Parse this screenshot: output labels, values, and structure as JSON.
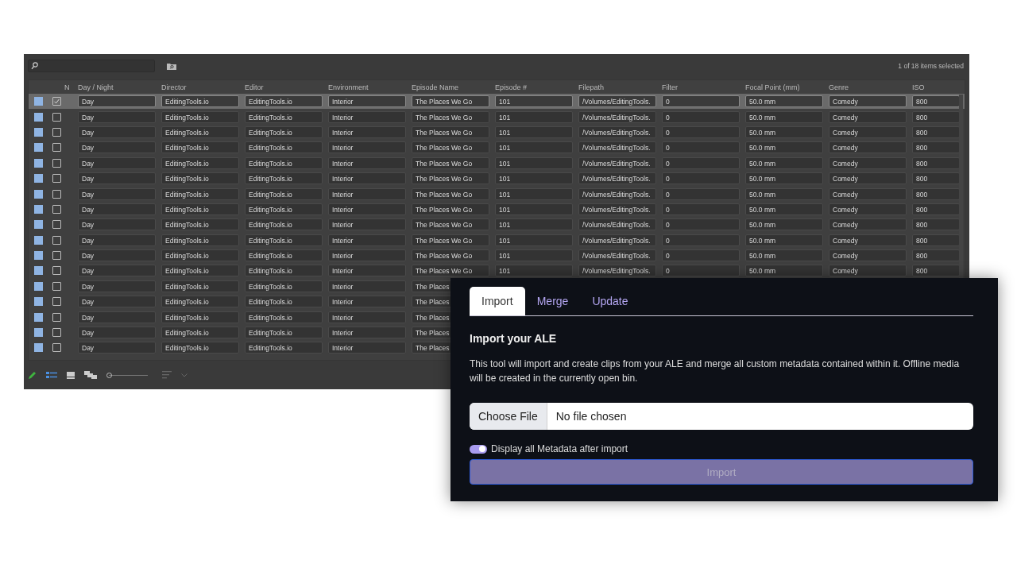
{
  "bin": {
    "status": "1 of 18 items selected",
    "n_header": "N",
    "columns": [
      "Day / Night",
      "Director",
      "Editor",
      "Environment",
      "Episode Name",
      "Episode #",
      "Filepath",
      "Filter",
      "Focal Point (mm)",
      "Genre",
      "ISO"
    ],
    "rows": [
      {
        "selected": true,
        "checked": true,
        "cells": [
          "Day",
          "EditingTools.io",
          "EditingTools.io",
          "Interior",
          "The Places We Go",
          "101",
          "/Volumes/EditingTools.",
          "0",
          "50.0 mm",
          "Comedy",
          "800"
        ]
      },
      {
        "selected": false,
        "checked": false,
        "cells": [
          "Day",
          "EditingTools.io",
          "EditingTools.io",
          "Interior",
          "The Places We Go",
          "101",
          "/Volumes/EditingTools.",
          "0",
          "50.0 mm",
          "Comedy",
          "800"
        ]
      },
      {
        "selected": false,
        "checked": false,
        "cells": [
          "Day",
          "EditingTools.io",
          "EditingTools.io",
          "Interior",
          "The Places We Go",
          "101",
          "/Volumes/EditingTools.",
          "0",
          "50.0 mm",
          "Comedy",
          "800"
        ]
      },
      {
        "selected": false,
        "checked": false,
        "cells": [
          "Day",
          "EditingTools.io",
          "EditingTools.io",
          "Interior",
          "The Places We Go",
          "101",
          "/Volumes/EditingTools.",
          "0",
          "50.0 mm",
          "Comedy",
          "800"
        ]
      },
      {
        "selected": false,
        "checked": false,
        "cells": [
          "Day",
          "EditingTools.io",
          "EditingTools.io",
          "Interior",
          "The Places We Go",
          "101",
          "/Volumes/EditingTools.",
          "0",
          "50.0 mm",
          "Comedy",
          "800"
        ]
      },
      {
        "selected": false,
        "checked": false,
        "cells": [
          "Day",
          "EditingTools.io",
          "EditingTools.io",
          "Interior",
          "The Places We Go",
          "101",
          "/Volumes/EditingTools.",
          "0",
          "50.0 mm",
          "Comedy",
          "800"
        ]
      },
      {
        "selected": false,
        "checked": false,
        "cells": [
          "Day",
          "EditingTools.io",
          "EditingTools.io",
          "Interior",
          "The Places We Go",
          "101",
          "/Volumes/EditingTools.",
          "0",
          "50.0 mm",
          "Comedy",
          "800"
        ]
      },
      {
        "selected": false,
        "checked": false,
        "cells": [
          "Day",
          "EditingTools.io",
          "EditingTools.io",
          "Interior",
          "The Places We Go",
          "101",
          "/Volumes/EditingTools.",
          "0",
          "50.0 mm",
          "Comedy",
          "800"
        ]
      },
      {
        "selected": false,
        "checked": false,
        "cells": [
          "Day",
          "EditingTools.io",
          "EditingTools.io",
          "Interior",
          "The Places We Go",
          "101",
          "/Volumes/EditingTools.",
          "0",
          "50.0 mm",
          "Comedy",
          "800"
        ]
      },
      {
        "selected": false,
        "checked": false,
        "cells": [
          "Day",
          "EditingTools.io",
          "EditingTools.io",
          "Interior",
          "The Places We Go",
          "101",
          "/Volumes/EditingTools.",
          "0",
          "50.0 mm",
          "Comedy",
          "800"
        ]
      },
      {
        "selected": false,
        "checked": false,
        "cells": [
          "Day",
          "EditingTools.io",
          "EditingTools.io",
          "Interior",
          "The Places We Go",
          "101",
          "/Volumes/EditingTools.",
          "0",
          "50.0 mm",
          "Comedy",
          "800"
        ]
      },
      {
        "selected": false,
        "checked": false,
        "cells": [
          "Day",
          "EditingTools.io",
          "EditingTools.io",
          "Interior",
          "The Places We Go",
          "101",
          "/Volumes/EditingTools.",
          "0",
          "50.0 mm",
          "Comedy",
          "800"
        ]
      },
      {
        "selected": false,
        "checked": false,
        "cells": [
          "Day",
          "EditingTools.io",
          "EditingTools.io",
          "Interior",
          "The Places"
        ]
      },
      {
        "selected": false,
        "checked": false,
        "cells": [
          "Day",
          "EditingTools.io",
          "EditingTools.io",
          "Interior",
          "The Places"
        ]
      },
      {
        "selected": false,
        "checked": false,
        "cells": [
          "Day",
          "EditingTools.io",
          "EditingTools.io",
          "Interior",
          "The Places"
        ]
      },
      {
        "selected": false,
        "checked": false,
        "cells": [
          "Day",
          "EditingTools.io",
          "EditingTools.io",
          "Interior",
          "The Places"
        ]
      },
      {
        "selected": false,
        "checked": false,
        "cells": [
          "Day",
          "EditingTools.io",
          "EditingTools.io",
          "Interior",
          "The Places"
        ]
      }
    ],
    "view_modes": [
      {
        "kind": "list",
        "selected": true
      },
      {
        "kind": "frame",
        "selected": false
      },
      {
        "kind": "script",
        "selected": false
      }
    ],
    "zoom_slider": {
      "level": 0
    }
  },
  "dialog": {
    "tabs": [
      {
        "label": "Import",
        "selected": true
      },
      {
        "label": "Merge",
        "selected": false
      },
      {
        "label": "Update",
        "selected": false
      }
    ],
    "heading": "Import your ALE",
    "description": "This tool will import and create clips from your ALE and merge all custom metadata contained within it. Offline media will be created in the currently open bin.",
    "file_input": {
      "button": "Choose File",
      "value": "No file chosen"
    },
    "toggle": {
      "label": "Display all Metadata after import",
      "on": true
    },
    "submit": {
      "label": "Import",
      "disabled": true
    }
  }
}
